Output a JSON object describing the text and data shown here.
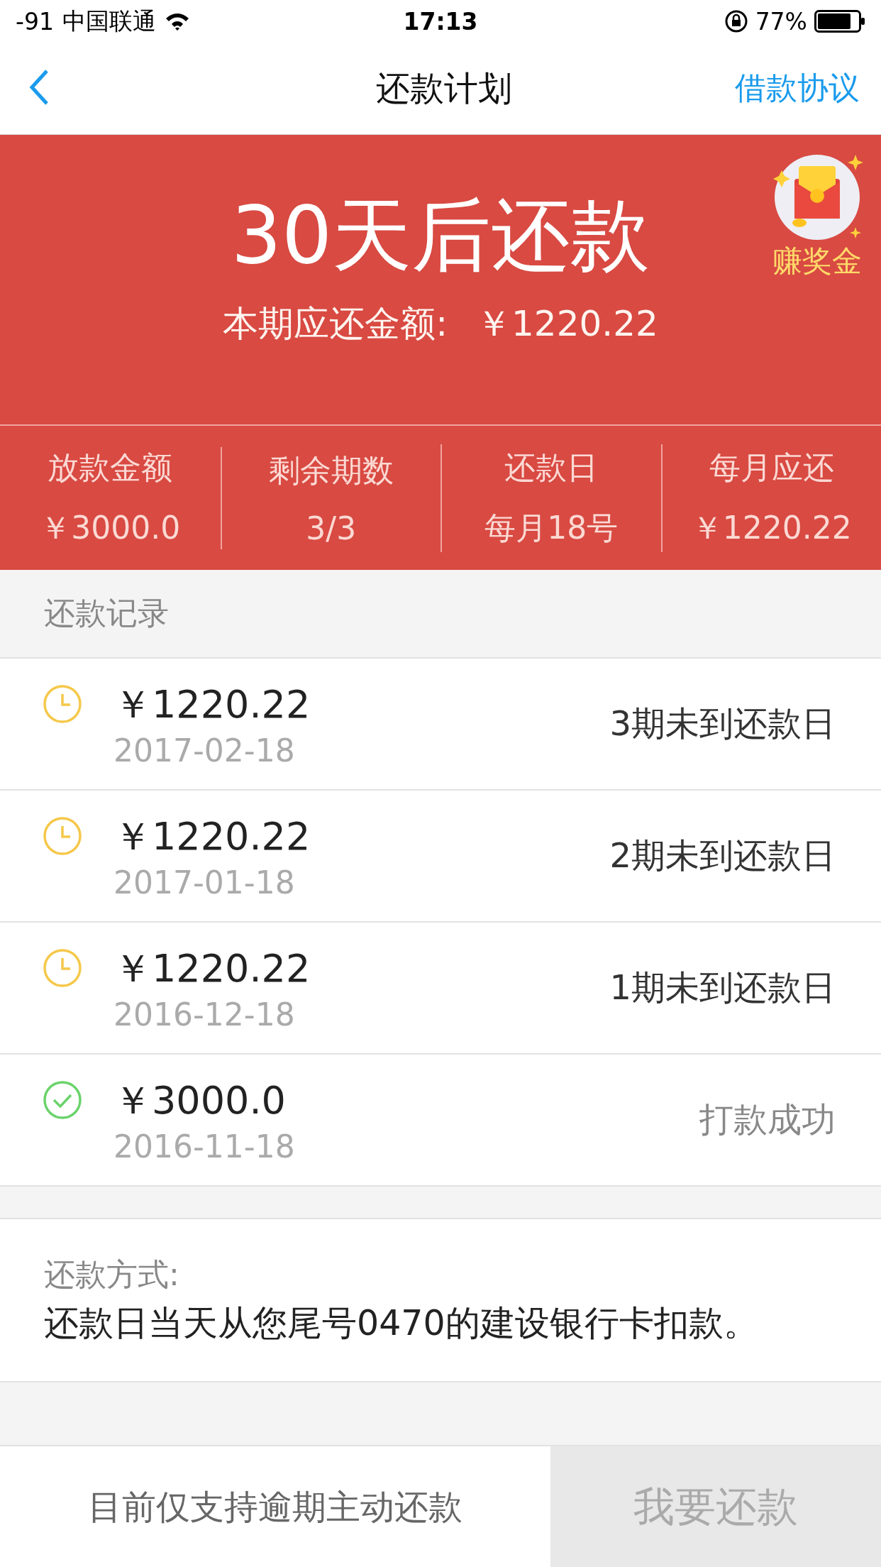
{
  "status_bar": {
    "signal": "-91",
    "carrier": "中国联通",
    "time": "17:13",
    "battery": "77%"
  },
  "nav": {
    "title": "还款计划",
    "action": "借款协议"
  },
  "header": {
    "countdown": "30天后还款",
    "amount_label": "本期应还金额:",
    "amount": "￥1220.22",
    "badge": "赚奖金"
  },
  "stats": [
    {
      "label": "放款金额",
      "value": "￥3000.0"
    },
    {
      "label": "剩余期数",
      "value": "3/3"
    },
    {
      "label": "还款日",
      "value": "每月18号"
    },
    {
      "label": "每月应还",
      "value": "￥1220.22"
    }
  ],
  "records": {
    "title": "还款记录",
    "items": [
      {
        "kind": "pending",
        "amount": "￥1220.22",
        "date": "2017-02-18",
        "status": "3期未到还款日"
      },
      {
        "kind": "pending",
        "amount": "￥1220.22",
        "date": "2017-01-18",
        "status": "2期未到还款日"
      },
      {
        "kind": "pending",
        "amount": "￥1220.22",
        "date": "2016-12-18",
        "status": "1期未到还款日"
      },
      {
        "kind": "paid",
        "amount": "￥3000.0",
        "date": "2016-11-18",
        "status": "打款成功"
      }
    ]
  },
  "method": {
    "label": "还款方式:",
    "text": "还款日当天从您尾号0470的建设银行卡扣款。"
  },
  "bottom": {
    "note": "目前仅支持逾期主动还款",
    "button": {
      "label": "我要还款",
      "disabled": true
    }
  }
}
